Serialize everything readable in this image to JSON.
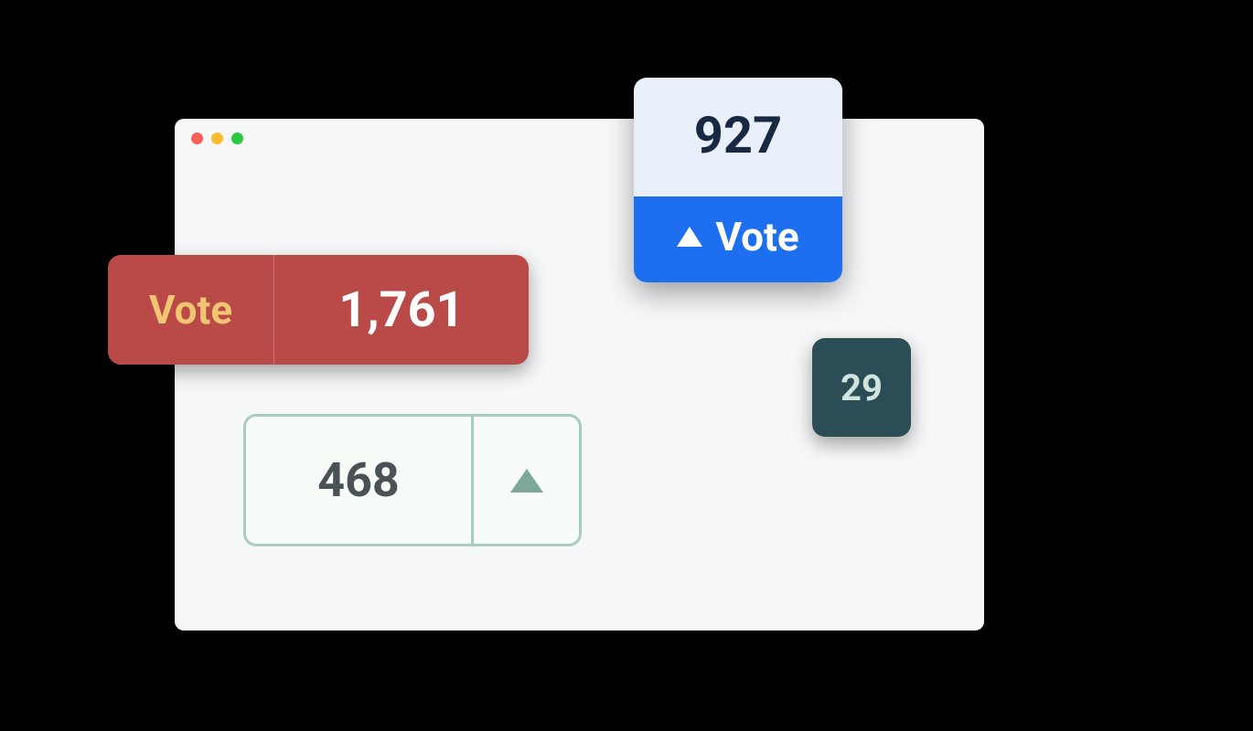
{
  "widgets": {
    "red": {
      "label": "Vote",
      "count": "1,761"
    },
    "blue": {
      "count": "927",
      "label": "Vote"
    },
    "green": {
      "count": "468"
    },
    "teal": {
      "count": "29"
    }
  }
}
